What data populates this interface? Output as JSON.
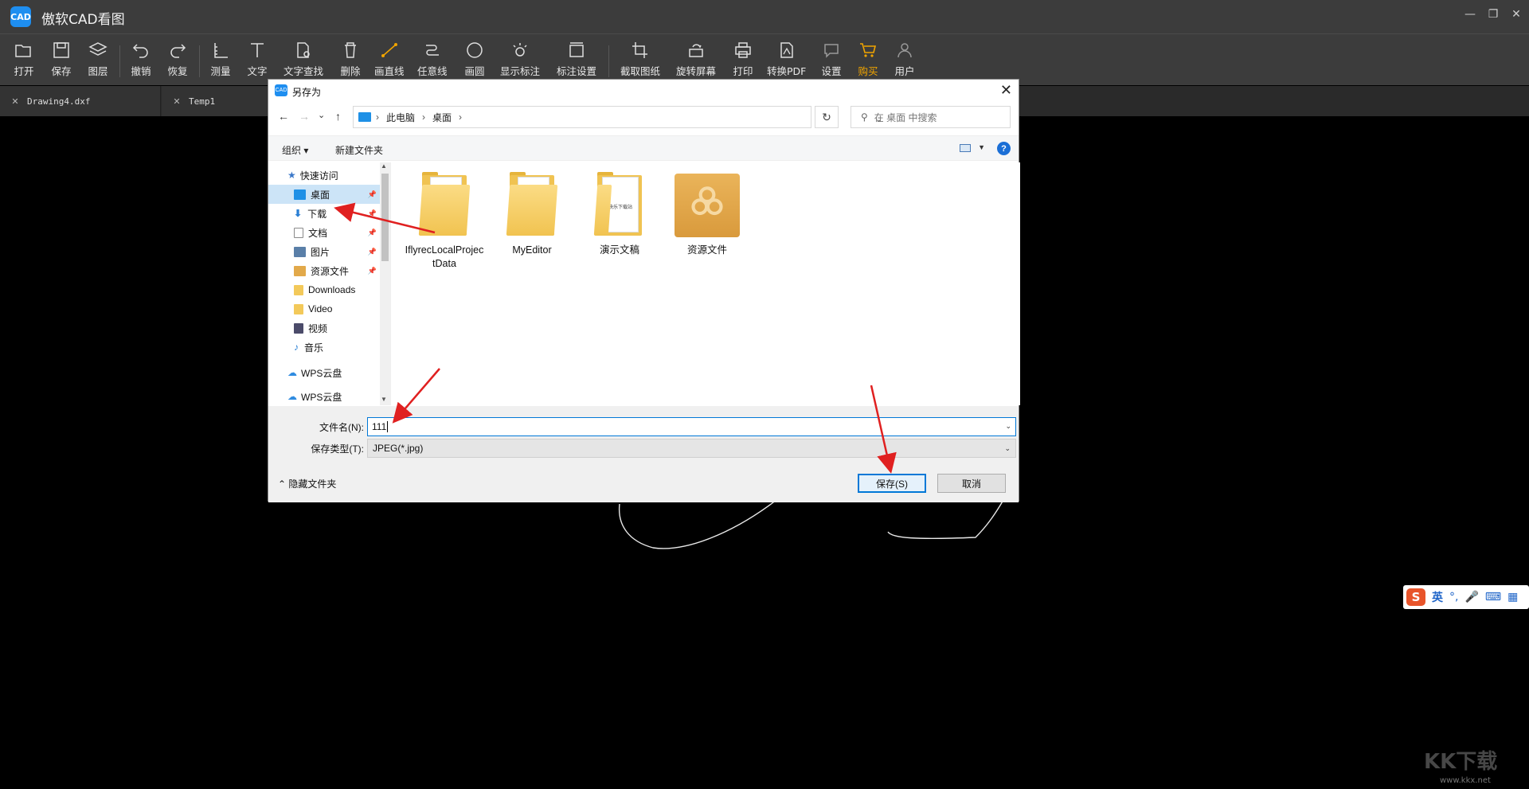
{
  "app": {
    "logo_text": "CAD",
    "title": "傲软CAD看图",
    "window_controls": [
      "—",
      "❐",
      "✕"
    ]
  },
  "toolbar": {
    "items": [
      {
        "label": "打开",
        "icon": "folder-open-icon"
      },
      {
        "label": "保存",
        "icon": "save-icon"
      },
      {
        "label": "图层",
        "icon": "layers-icon"
      },
      {
        "label": "撤销",
        "icon": "undo-icon"
      },
      {
        "label": "恢复",
        "icon": "redo-icon"
      },
      {
        "label": "测量",
        "icon": "measure-icon"
      },
      {
        "label": "文字",
        "icon": "text-icon"
      },
      {
        "label": "文字查找",
        "icon": "text-search-icon"
      },
      {
        "label": "删除",
        "icon": "trash-icon"
      },
      {
        "label": "画直线",
        "icon": "line-icon"
      },
      {
        "label": "任意线",
        "icon": "freeline-icon"
      },
      {
        "label": "画圆",
        "icon": "circle-icon"
      },
      {
        "label": "显示标注",
        "icon": "show-annotation-icon"
      },
      {
        "label": "标注设置",
        "icon": "annotation-settings-icon"
      },
      {
        "label": "截取图纸",
        "icon": "crop-icon"
      },
      {
        "label": "旋转屏幕",
        "icon": "rotate-icon"
      },
      {
        "label": "打印",
        "icon": "printer-icon"
      },
      {
        "label": "转换PDF",
        "icon": "pdf-icon"
      },
      {
        "label": "设置",
        "icon": "chat-settings-icon"
      },
      {
        "label": "购买",
        "icon": "cart-icon"
      },
      {
        "label": "用户",
        "icon": "user-icon"
      }
    ],
    "highlight_color": "#f0a400"
  },
  "tabs": [
    {
      "label": "Drawing4.dxf"
    },
    {
      "label": "Temp1"
    }
  ],
  "dialog": {
    "icon_text": "CAD",
    "title": "另存为",
    "close": "✕",
    "nav": {
      "back": "←",
      "forward": "→",
      "recent": "⌄",
      "up": "↑"
    },
    "address": {
      "parts": [
        "此电脑",
        "桌面"
      ],
      "separator": "›"
    },
    "refresh": "↻",
    "search_placeholder": "在 桌面 中搜索",
    "commands": {
      "organize": "组织 ▾",
      "new_folder": "新建文件夹",
      "help": "?"
    },
    "sidebar": [
      {
        "label": "快速访问",
        "icon": "star-icon",
        "color": "#3a78c9"
      },
      {
        "label": "桌面",
        "icon": "desktop-icon",
        "color": "#1e90e6",
        "selected": true,
        "pinned": true
      },
      {
        "label": "下载",
        "icon": "download-icon",
        "color": "#2a7fd4",
        "pinned": true
      },
      {
        "label": "文档",
        "icon": "document-icon",
        "color": "#8a8a8a",
        "pinned": true
      },
      {
        "label": "图片",
        "icon": "picture-icon",
        "color": "#5a7fa8",
        "pinned": true
      },
      {
        "label": "资源文件",
        "icon": "resource-folder-icon",
        "color": "#e2a94a",
        "pinned": true
      },
      {
        "label": "Downloads",
        "icon": "folder-icon",
        "color": "#f3c95a"
      },
      {
        "label": "Video",
        "icon": "folder-icon",
        "color": "#f3c95a"
      },
      {
        "label": "视频",
        "icon": "video-icon",
        "color": "#4b4b6a"
      },
      {
        "label": "音乐",
        "icon": "music-icon",
        "color": "#2a7fd4"
      },
      {
        "label": "WPS云盘",
        "icon": "cloud-icon",
        "color": "#2f8be0"
      },
      {
        "label": "WPS云盘",
        "icon": "cloud-icon",
        "color": "#2f8be0"
      }
    ],
    "files": [
      {
        "label": "IflyrecLocalProjectData",
        "icon": "folder-icon"
      },
      {
        "label": "MyEditor",
        "icon": "folder-icon"
      },
      {
        "label": "演示文稿",
        "icon": "folder-icon",
        "paper_text": "快乐下载站"
      },
      {
        "label": "资源文件",
        "icon": "resource-folder-icon"
      }
    ],
    "filename_label": "文件名(N):",
    "filename_value": "111",
    "filetype_label": "保存类型(T):",
    "filetype_value": "JPEG(*.jpg)",
    "hide_folders": "隐藏文件夹",
    "save_button": "保存(S)",
    "cancel_button": "取消",
    "accent": "#0078d7"
  },
  "ime": {
    "logo": "S",
    "lang": "英",
    "items": [
      "°,",
      "🎤",
      "⌨",
      "▦"
    ]
  },
  "watermark": {
    "text": "KK下载",
    "url": "www.kkx.net"
  }
}
